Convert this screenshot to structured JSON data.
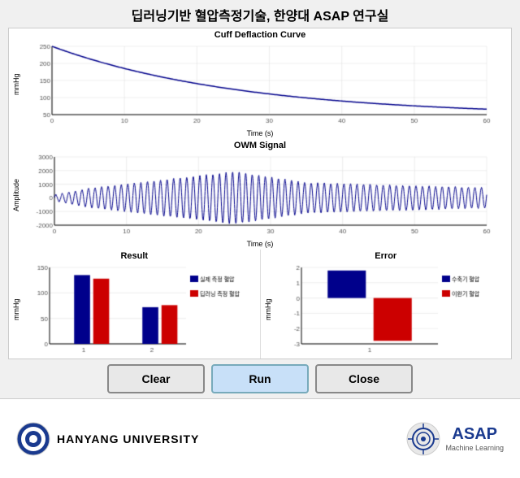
{
  "title": "딥러닝기반 혈압측정기술, 한양대 ASAP 연구실",
  "cuff_chart": {
    "title": "Cuff Deflaction Curve",
    "y_label": "mmHg",
    "x_label": "Time (s)",
    "x_max": 60,
    "y_max": 250,
    "y_min": 50
  },
  "owm_chart": {
    "title": "OWM Signal",
    "y_label": "Amplitude",
    "x_label": "Time (s)",
    "y_max": 3000,
    "y_min": -2000
  },
  "result_chart": {
    "title": "Result",
    "y_label": "mmHg",
    "legend": [
      "실제 측정 혈압",
      "딥러닝 측정 혈압"
    ],
    "bars": [
      {
        "group": 1,
        "values": [
          135,
          128
        ]
      },
      {
        "group": 2,
        "values": [
          72,
          76
        ]
      }
    ]
  },
  "error_chart": {
    "title": "Error",
    "y_label": "mmHg",
    "legend": [
      "수축기 혈압",
      "이완기 혈압"
    ],
    "bars": [
      {
        "group": 1,
        "systolic": 1.8,
        "diastolic": -2.8
      }
    ]
  },
  "buttons": {
    "clear": "Clear",
    "run": "Run",
    "close": "Close"
  },
  "footer": {
    "university_name": "HANYANG UNIVERSITY",
    "asap_label": "ASAP",
    "asap_sub": "Machine Learning"
  }
}
